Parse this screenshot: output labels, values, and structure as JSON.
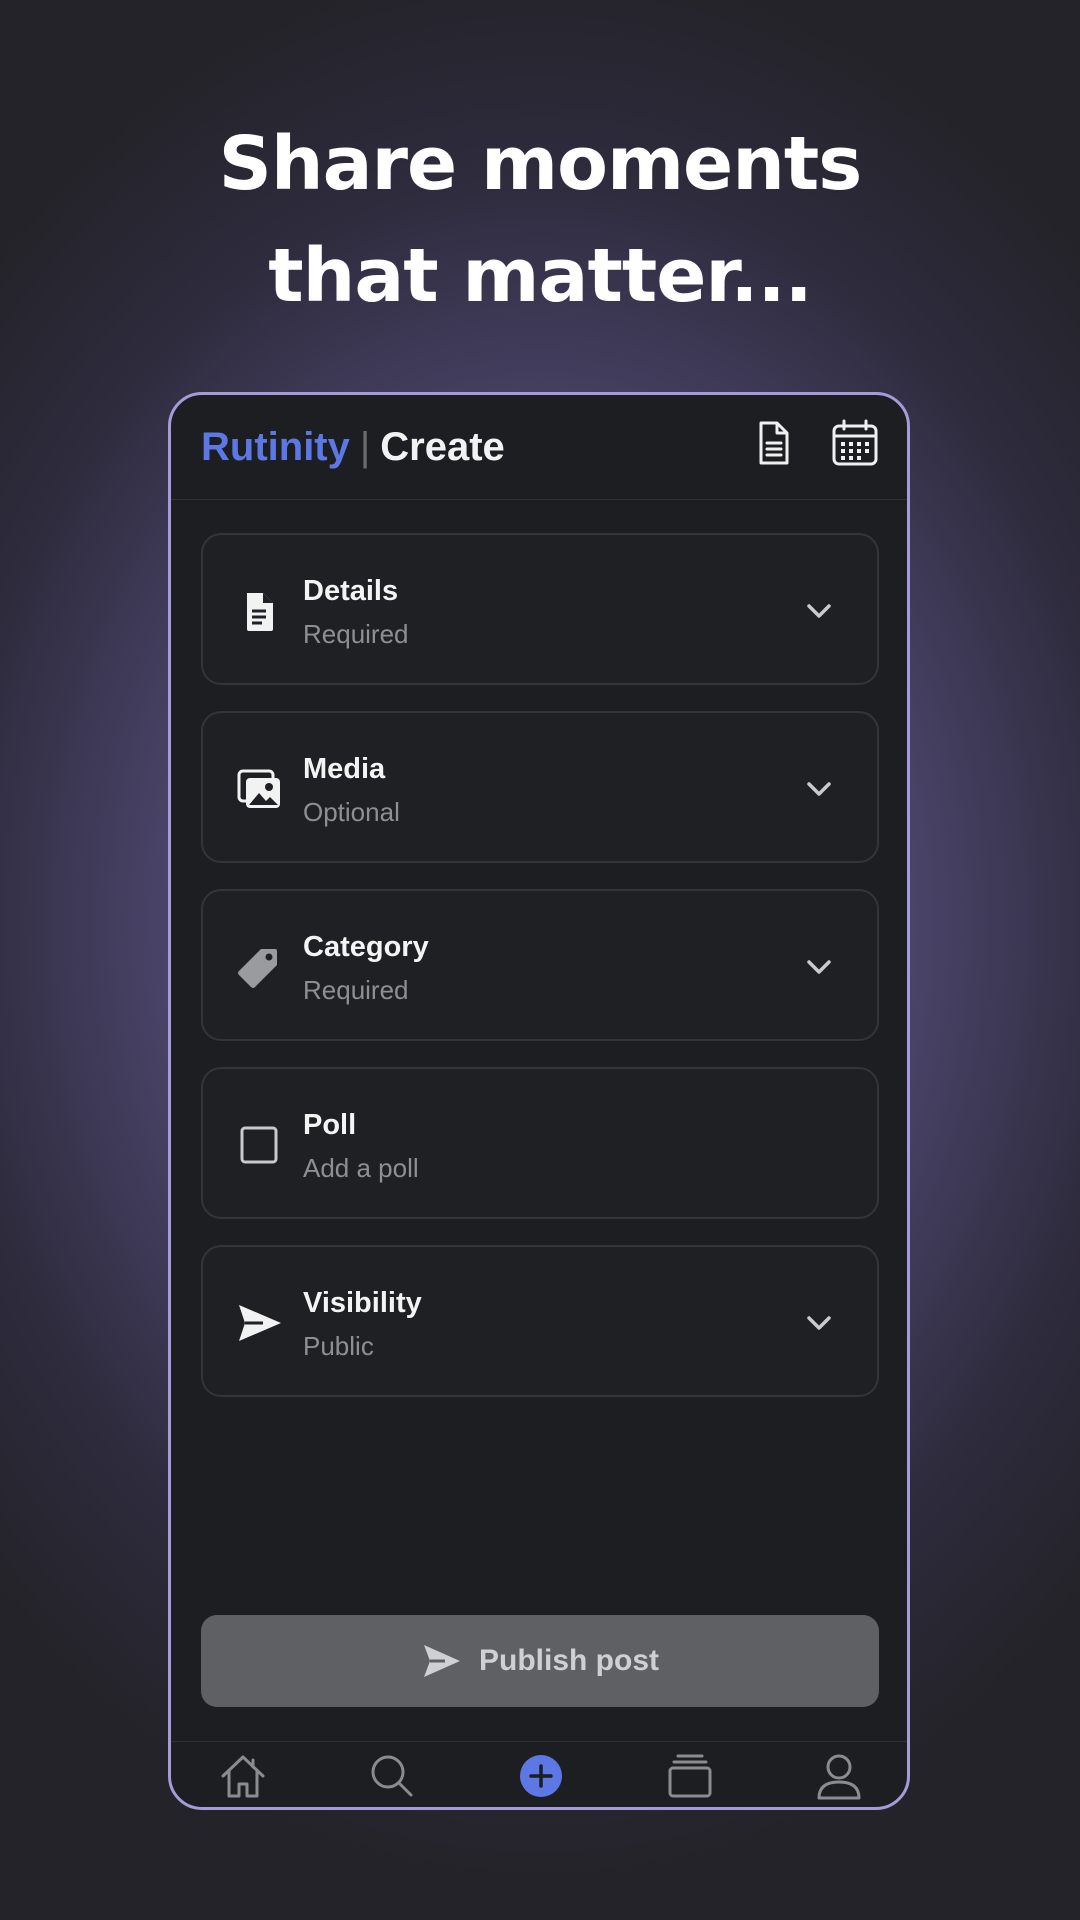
{
  "headline": {
    "line1": "Share moments",
    "line2": "that matter..."
  },
  "header": {
    "brand": "Rutinity",
    "separator": "|",
    "page_title": "Create",
    "icons": [
      "document-icon",
      "calendar-icon"
    ]
  },
  "sections": [
    {
      "title": "Details",
      "subtitle": "Required",
      "icon": "document-icon",
      "expandable": true
    },
    {
      "title": "Media",
      "subtitle": "Optional",
      "icon": "image-icon",
      "expandable": true
    },
    {
      "title": "Category",
      "subtitle": "Required",
      "icon": "tag-icon",
      "expandable": true
    },
    {
      "title": "Poll",
      "subtitle": "Add a poll",
      "icon": "checkbox-icon",
      "expandable": false
    },
    {
      "title": "Visibility",
      "subtitle": "Public",
      "icon": "send-icon",
      "expandable": true
    }
  ],
  "publish": {
    "label": "Publish post",
    "icon": "send-icon"
  },
  "nav": {
    "items": [
      "home-icon",
      "search-icon",
      "add-icon",
      "collections-icon",
      "profile-icon"
    ],
    "active": "add-icon"
  },
  "colors": {
    "brand": "#5d78e4",
    "frame": "#a49bd8",
    "app_bg": "#1d1e21",
    "button_disabled": "#5f6064",
    "active_nav": "#5d78e4"
  }
}
